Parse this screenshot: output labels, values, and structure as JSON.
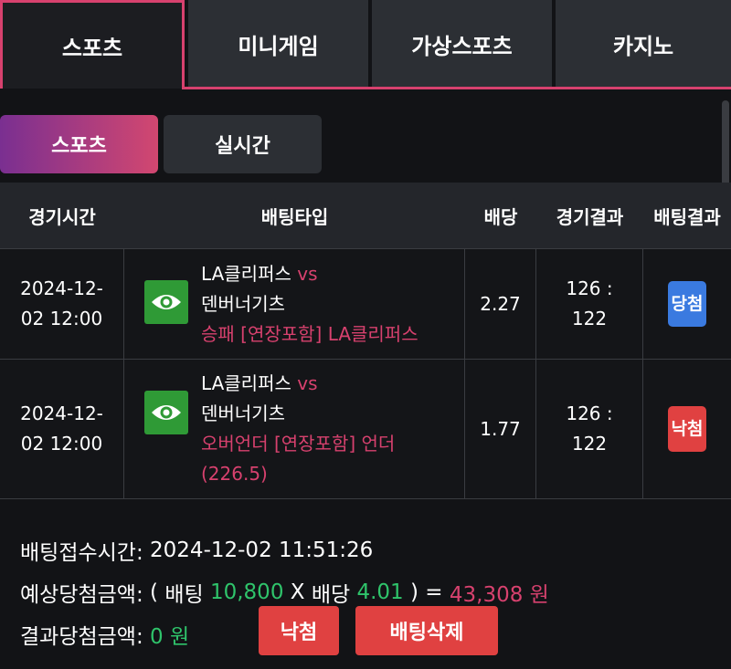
{
  "top_tabs": [
    {
      "label": "스포츠",
      "active": true
    },
    {
      "label": "미니게임",
      "active": false
    },
    {
      "label": "가상스포츠",
      "active": false
    },
    {
      "label": "카지노",
      "active": false
    }
  ],
  "sub_tabs": [
    {
      "label": "스포츠",
      "active": true
    },
    {
      "label": "실시간",
      "active": false
    }
  ],
  "table": {
    "headers": [
      "경기시간",
      "배팅타입",
      "배당",
      "경기결과",
      "배팅결과"
    ],
    "rows": [
      {
        "time_line1": "2024-12-",
        "time_line2": "02 12:00",
        "home": "LA클리퍼스",
        "vs": "vs",
        "away": "덴버너기츠",
        "pick_line1": "승패 [연장포함] LA클리퍼스",
        "pick_line2": "",
        "odds": "2.27",
        "score_line1": "126 :",
        "score_line2": "122",
        "result": "당첨"
      },
      {
        "time_line1": "2024-12-",
        "time_line2": "02 12:00",
        "home": "LA클리퍼스",
        "vs": "vs",
        "away": "덴버너기츠",
        "pick_line1": "오버언더 [연장포함] 언더",
        "pick_line2": "(226.5)",
        "odds": "1.77",
        "score_line1": "126 :",
        "score_line2": "122",
        "result": "낙첨"
      }
    ]
  },
  "summary": {
    "accept_label": "배팅접수시간:",
    "accept_time": "2024-12-02 11:51:26",
    "expected_label": "예상당첨금액:",
    "open_paren": "(",
    "bet_label": "배팅",
    "bet_amount": "10,800",
    "times": "X",
    "odds_label": "배당",
    "total_odds": "4.01",
    "close_eq": ") =",
    "expected_amount": "43,308 원",
    "result_label": "결과당첨금액:",
    "result_amount": "0 원",
    "status_button": "낙첨",
    "delete_button": "배팅삭제"
  },
  "colors": {
    "accent": "#d7416e",
    "win_badge": "#3a7ae0",
    "lose_badge": "#e04141",
    "money_green": "#2fc46b",
    "eye_icon_bg": "#2f9a36"
  }
}
